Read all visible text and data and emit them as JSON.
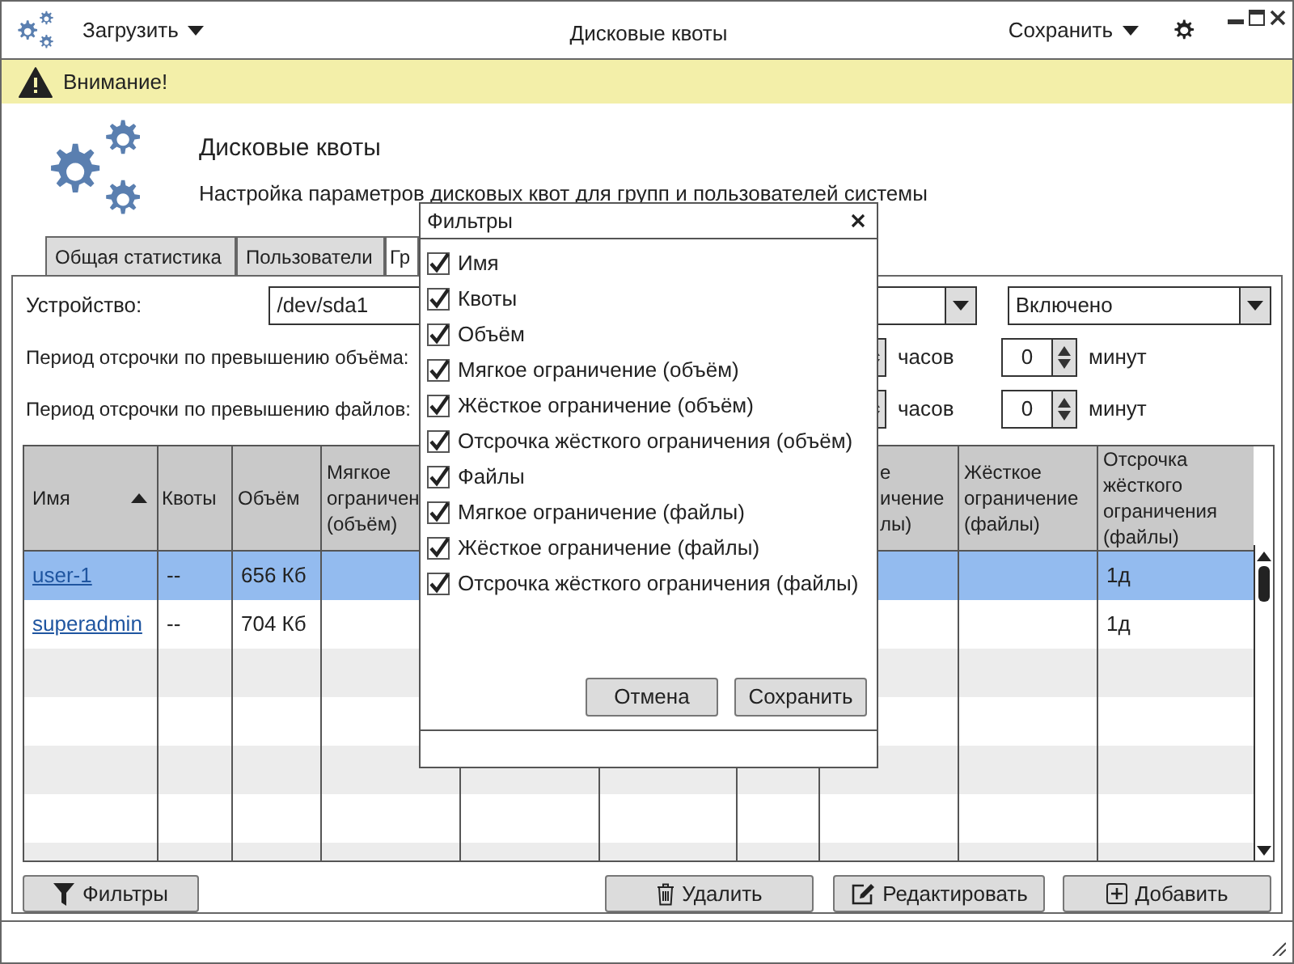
{
  "titlebar": {
    "load_menu": "Загрузить",
    "title": "Дисковые квоты",
    "save_menu": "Сохранить"
  },
  "warning": "Внимание!",
  "header": {
    "title": "Дисковые квоты",
    "subtitle": "Настройка параметров дисковых квот для групп и пользователей системы"
  },
  "tabs": [
    {
      "label": "Общая статистика",
      "selected": false
    },
    {
      "label": "Пользователи",
      "selected": false
    },
    {
      "label": "Гр",
      "selected": true
    }
  ],
  "device": {
    "label": "Устройство:",
    "value": "/dev/sda1",
    "state": "Включено"
  },
  "grace": [
    {
      "label": "Период отсрочки по превышению объёма:",
      "hours_unit": "часов",
      "minutes": "0",
      "minutes_unit": "минут"
    },
    {
      "label": "Период отсрочки по превышению файлов:",
      "hours_unit": "часов",
      "minutes": "0",
      "minutes_unit": "минут"
    }
  ],
  "table": {
    "columns": [
      {
        "lines": [
          "Имя"
        ],
        "sorted": true
      },
      {
        "lines": [
          "Квоты"
        ]
      },
      {
        "lines": [
          "Объём"
        ]
      },
      {
        "lines": [
          "Мягкое",
          "ограничен",
          "(объём)"
        ]
      },
      {},
      {},
      {},
      {
        "lines": [
          "е",
          "ичение",
          "лы)"
        ]
      },
      {
        "lines": [
          "Жёсткое",
          "ограничение",
          "(файлы)"
        ]
      },
      {
        "lines": [
          "Отсрочка",
          "жёсткого",
          "ограничения",
          "(файлы)"
        ]
      }
    ],
    "rows": [
      {
        "name": "user-1",
        "quotas": "--",
        "size": "656 Кб",
        "files_grace": "1д",
        "selected": true
      },
      {
        "name": "superadmin",
        "quotas": "--",
        "size": "704 Кб",
        "files_grace": "1д",
        "selected": false
      }
    ]
  },
  "buttons": {
    "filters": "Фильтры",
    "delete": "Удалить",
    "edit": "Редактировать",
    "add": "Добавить"
  },
  "dialog": {
    "title": "Фильтры",
    "options": [
      {
        "label": "Имя",
        "checked": true
      },
      {
        "label": "Квоты",
        "checked": true
      },
      {
        "label": "Объём",
        "checked": true
      },
      {
        "label": "Мягкое ограничение (объём)",
        "checked": true
      },
      {
        "label": "Жёсткое ограничение (объём)",
        "checked": true
      },
      {
        "label": "Отсрочка жёсткого ограничения (объём)",
        "checked": true
      },
      {
        "label": "Файлы",
        "checked": true
      },
      {
        "label": "Мягкое ограничение (файлы)",
        "checked": true
      },
      {
        "label": "Жёсткое ограничение (файлы)",
        "checked": true
      },
      {
        "label": "Отсрочка жёсткого ограничения (файлы)",
        "checked": true
      }
    ],
    "cancel": "Отмена",
    "save": "Сохранить"
  }
}
